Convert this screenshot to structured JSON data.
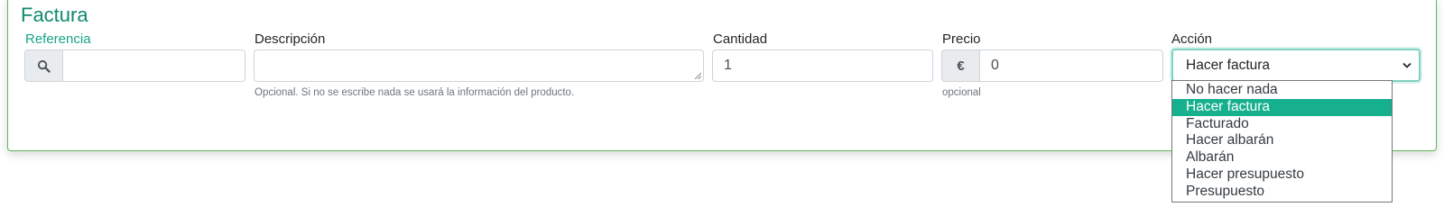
{
  "panel": {
    "title": "Factura"
  },
  "fields": {
    "referencia": {
      "label": "Referencia",
      "value": "",
      "icon": "search-icon"
    },
    "descripcion": {
      "label": "Descripción",
      "value": "",
      "help": "Opcional. Si no se escribe nada se usará la información del producto."
    },
    "cantidad": {
      "label": "Cantidad",
      "value": "1"
    },
    "precio": {
      "label": "Precio",
      "addon": "€",
      "value": "0",
      "help": "opcional"
    },
    "accion": {
      "label": "Acción",
      "selected": "Hacer factura",
      "options": [
        "No hacer nada",
        "Hacer factura",
        "Facturado",
        "Hacer albarán",
        "Albarán",
        "Hacer presupuesto",
        "Presupuesto"
      ]
    }
  },
  "colors": {
    "accent": "#17a589",
    "panel_border": "#5cb85c",
    "selected_option": "#17b08f"
  }
}
